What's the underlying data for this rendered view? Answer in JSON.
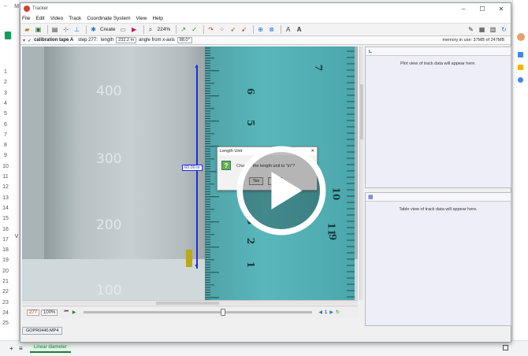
{
  "sheet": {
    "app_label": "M",
    "row_numbers": [
      "1",
      "2",
      "3",
      "4",
      "5",
      "6",
      "7",
      "8",
      "9",
      "10",
      "11",
      "12",
      "13",
      "14",
      "15",
      "16",
      "17",
      "18",
      "19",
      "20",
      "21",
      "22",
      "23",
      "24",
      "25"
    ],
    "column_v": "V",
    "sheet_tab": "Linear diameter"
  },
  "window": {
    "title": "Tracker",
    "menu": [
      "File",
      "Edit",
      "Video",
      "Track",
      "Coordinate System",
      "View",
      "Help"
    ]
  },
  "toolbar": {
    "create_label": "Create",
    "zoom_label": "224%"
  },
  "trackbar": {
    "track_name": "calibration tape A",
    "step_label": "step 277:",
    "length_label": "length",
    "length_value": "232.2 m",
    "angle_label": "angle from x-axis",
    "angle_value": "88.0°",
    "memory": "memory in use: 37MB of 247MB"
  },
  "video": {
    "grad_labels": [
      "400",
      "300",
      "200",
      "100"
    ],
    "ruler_labels": [
      "9",
      "10",
      "11",
      "1",
      "2",
      "3",
      "4",
      "5",
      "6",
      "7"
    ],
    "length_tag": "60.00 in"
  },
  "dialog": {
    "title": "Length Unit",
    "message": "Change the length unit to \"in\"?",
    "yes": "Yes",
    "no": "No"
  },
  "player": {
    "frame": "277",
    "zoom": "100%",
    "step_size": "1",
    "progress": 0.6
  },
  "file_tab": "GOPR0440.MP4",
  "plot_panel": {
    "message": "Plot view of track data will appear here."
  },
  "table_panel": {
    "message": "Table view of track data will appear here."
  },
  "colors": {
    "accent": "#1f2fd8",
    "water": "#59b7bb",
    "panel": "#eeeef8"
  }
}
